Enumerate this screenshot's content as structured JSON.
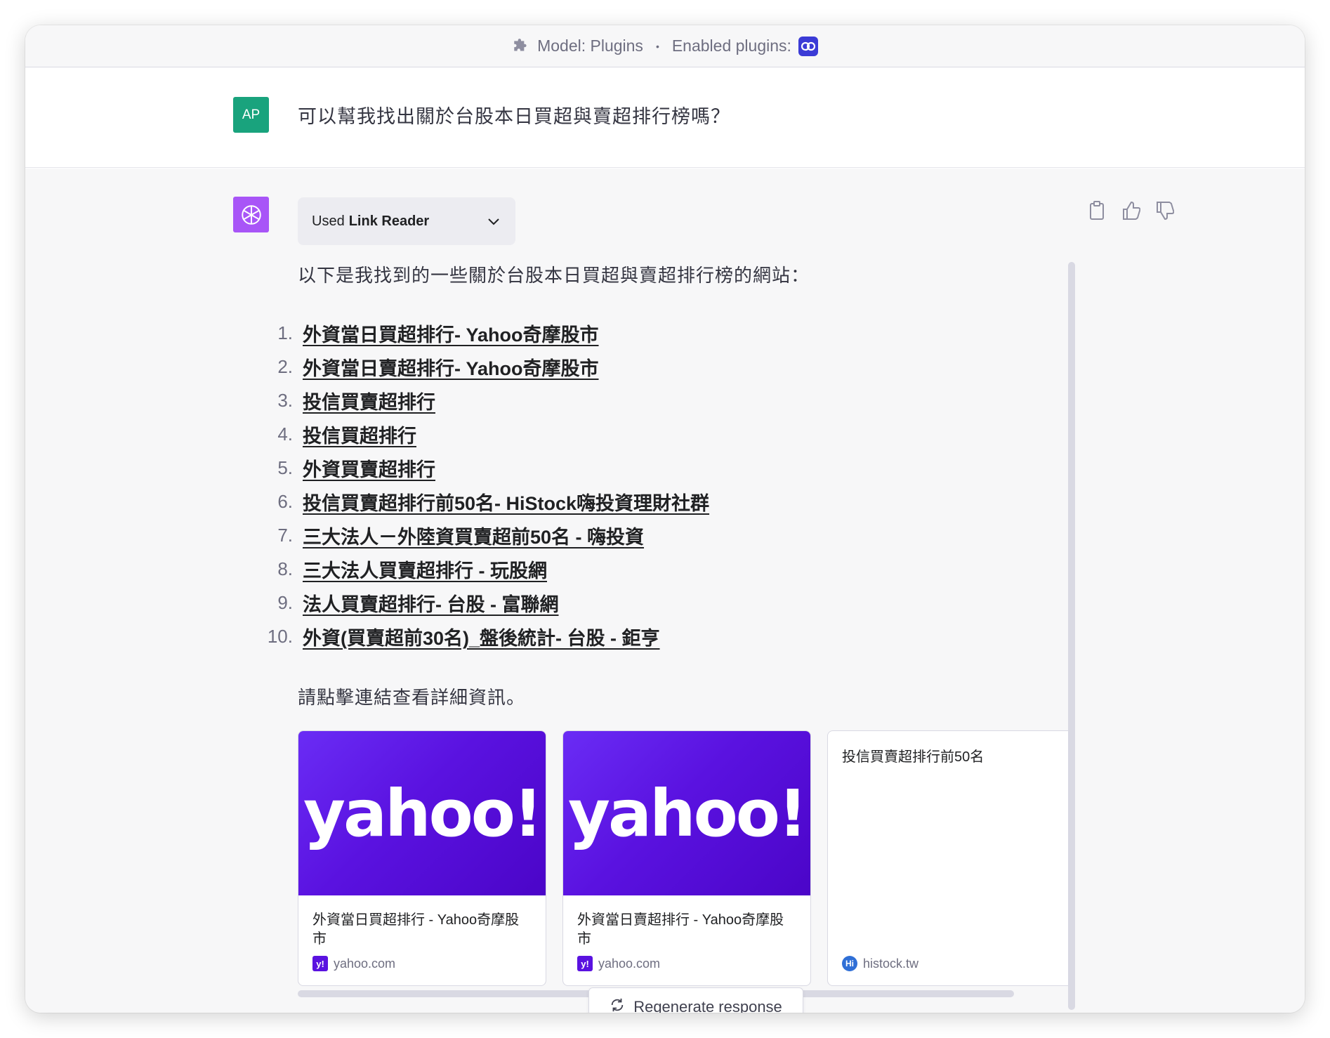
{
  "topbar": {
    "model_label": "Model: Plugins",
    "separator": "•",
    "enabled_label": "Enabled plugins:"
  },
  "user": {
    "avatar_initials": "AP",
    "message": "可以幫我找出關於台股本日買超與賣超排行榜嗎？"
  },
  "assistant": {
    "used_prefix": "Used",
    "used_plugin": "Link Reader",
    "intro": "以下是我找到的一些關於台股本日買超與賣超排行榜的網站：",
    "links": [
      {
        "num": "1.",
        "text": "外資當日買超排行- Yahoo奇摩股市"
      },
      {
        "num": "2.",
        "text": "外資當日賣超排行- Yahoo奇摩股市"
      },
      {
        "num": "3.",
        "text": "投信買賣超排行"
      },
      {
        "num": "4.",
        "text": "投信買超排行"
      },
      {
        "num": "5.",
        "text": "外資買賣超排行"
      },
      {
        "num": "6.",
        "text": "投信買賣超排行前50名- HiStock嗨投資理財社群"
      },
      {
        "num": "7.",
        "text": "三大法人－外陸資買賣超前50名 - 嗨投資"
      },
      {
        "num": "8.",
        "text": "三大法人買賣超排行 - 玩股網"
      },
      {
        "num": "9.",
        "text": "法人買賣超排行- 台股 - 富聯網"
      },
      {
        "num": "10.",
        "text": "外資(買賣超前30名)_盤後統計- 台股 - 鉅亨"
      }
    ],
    "outro": "請點擊連結查看詳細資訊。",
    "cards": [
      {
        "logo": "yahoo!",
        "title": "外資當日買超排行 - Yahoo奇摩股市",
        "favicon": "y!",
        "source": "yahoo.com"
      },
      {
        "logo": "yahoo!",
        "title": "外資當日賣超排行 - Yahoo奇摩股市",
        "favicon": "y!",
        "source": "yahoo.com"
      },
      {
        "title": "投信買賣超排行前50名",
        "favicon": "Hi",
        "source": "histock.tw"
      }
    ],
    "regenerate_label": "Regenerate response"
  },
  "colors": {
    "user_avatar": "#19a37d",
    "bot_avatar": "#a855f7",
    "yahoo_purple": "#5a12e0",
    "plugin_badge": "#3b3bd6"
  }
}
